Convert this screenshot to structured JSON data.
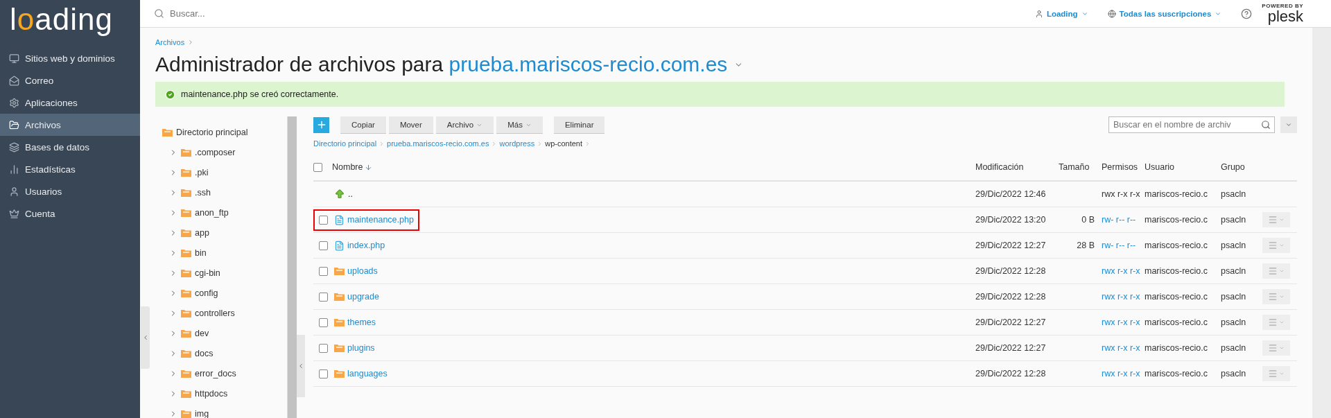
{
  "sidebar": {
    "logo": "loading",
    "items": [
      {
        "label": "Sitios web y dominios",
        "selected": false
      },
      {
        "label": "Correo",
        "selected": false
      },
      {
        "label": "Aplicaciones",
        "selected": false
      },
      {
        "label": "Archivos",
        "selected": true
      },
      {
        "label": "Bases de datos",
        "selected": false
      },
      {
        "label": "Estadísticas",
        "selected": false
      },
      {
        "label": "Usuarios",
        "selected": false
      },
      {
        "label": "Cuenta",
        "selected": false
      }
    ]
  },
  "topbar": {
    "search": {
      "placeholder": "Buscar..."
    },
    "user": "Loading",
    "subscriptions": "Todas las suscripciones",
    "brand": {
      "tagline": "POWERED BY",
      "name": "plesk"
    }
  },
  "breadcrumb": [
    "Archivos"
  ],
  "title": {
    "prefix": "Administrador de archivos para",
    "domain": "prueba.mariscos-recio.com.es"
  },
  "alert": {
    "kind": "success",
    "text": "maintenance.php se creó correctamente."
  },
  "tree": {
    "root": "Directorio principal",
    "children": [
      {
        "name": ".composer",
        "expanded": false
      },
      {
        "name": ".pki",
        "expanded": false
      },
      {
        "name": ".ssh",
        "expanded": false
      },
      {
        "name": "anon_ftp",
        "expanded": false
      },
      {
        "name": "app",
        "expanded": false
      },
      {
        "name": "bin",
        "expanded": false
      },
      {
        "name": "cgi-bin",
        "expanded": false
      },
      {
        "name": "config",
        "expanded": false
      },
      {
        "name": "controllers",
        "expanded": false
      },
      {
        "name": "dev",
        "expanded": false
      },
      {
        "name": "docs",
        "expanded": false
      },
      {
        "name": "error_docs",
        "expanded": false
      },
      {
        "name": "httpdocs",
        "expanded": false
      },
      {
        "name": "img",
        "expanded": false
      }
    ]
  },
  "toolbar": {
    "buttons": [
      {
        "kind": "add"
      },
      {
        "kind": "plain",
        "label": "Copiar"
      },
      {
        "kind": "plain",
        "label": "Mover"
      },
      {
        "kind": "menu",
        "label": "Archivo"
      },
      {
        "kind": "menu",
        "label": "Más"
      },
      {
        "kind": "plain",
        "label": "Eliminar"
      }
    ],
    "search": {
      "placeholder": "Buscar en el nombre de archiv"
    }
  },
  "path": [
    "Directorio principal",
    "prueba.mariscos-recio.com.es",
    "wordpress",
    "wp-content"
  ],
  "table": {
    "select_all_checked": false,
    "columns": [
      {
        "label": "Nombre",
        "sorted": true
      },
      {
        "label": "Modificación",
        "sorted": false
      },
      {
        "label": "Tamaño",
        "sorted": false
      },
      {
        "label": "Permisos",
        "sorted": false
      },
      {
        "label": "Usuario",
        "sorted": false
      },
      {
        "label": "Grupo",
        "sorted": false
      }
    ],
    "rows": [
      {
        "kind": "parent",
        "name": "..",
        "modified": "29/Dic/2022 12:46",
        "permissions": "rwx r-x r-x",
        "user": "mariscos-recio.c",
        "group": "psacln"
      },
      {
        "kind": "file",
        "name": "maintenance.php",
        "modified": "29/Dic/2022 13:20",
        "size": "0 B",
        "permissions": "rw- r-- r--",
        "user": "mariscos-recio.c",
        "group": "psacln",
        "checked": false,
        "highlighted": true
      },
      {
        "kind": "file",
        "name": "index.php",
        "modified": "29/Dic/2022 12:27",
        "size": "28 B",
        "permissions": "rw- r-- r--",
        "user": "mariscos-recio.c",
        "group": "psacln",
        "checked": false,
        "highlighted": false
      },
      {
        "kind": "folder",
        "name": "uploads",
        "modified": "29/Dic/2022 12:28",
        "permissions": "rwx r-x r-x",
        "user": "mariscos-recio.c",
        "group": "psacln",
        "checked": false,
        "highlighted": false
      },
      {
        "kind": "folder",
        "name": "upgrade",
        "modified": "29/Dic/2022 12:28",
        "permissions": "rwx r-x r-x",
        "user": "mariscos-recio.c",
        "group": "psacln",
        "checked": false,
        "highlighted": false
      },
      {
        "kind": "folder",
        "name": "themes",
        "modified": "29/Dic/2022 12:27",
        "permissions": "rwx r-x r-x",
        "user": "mariscos-recio.c",
        "group": "psacln",
        "checked": false,
        "highlighted": false
      },
      {
        "kind": "folder",
        "name": "plugins",
        "modified": "29/Dic/2022 12:27",
        "permissions": "rwx r-x r-x",
        "user": "mariscos-recio.c",
        "group": "psacln",
        "checked": false,
        "highlighted": false
      },
      {
        "kind": "folder",
        "name": "languages",
        "modified": "29/Dic/2022 12:28",
        "permissions": "rwx r-x r-x",
        "user": "mariscos-recio.c",
        "group": "psacln",
        "checked": false,
        "highlighted": false
      }
    ]
  }
}
